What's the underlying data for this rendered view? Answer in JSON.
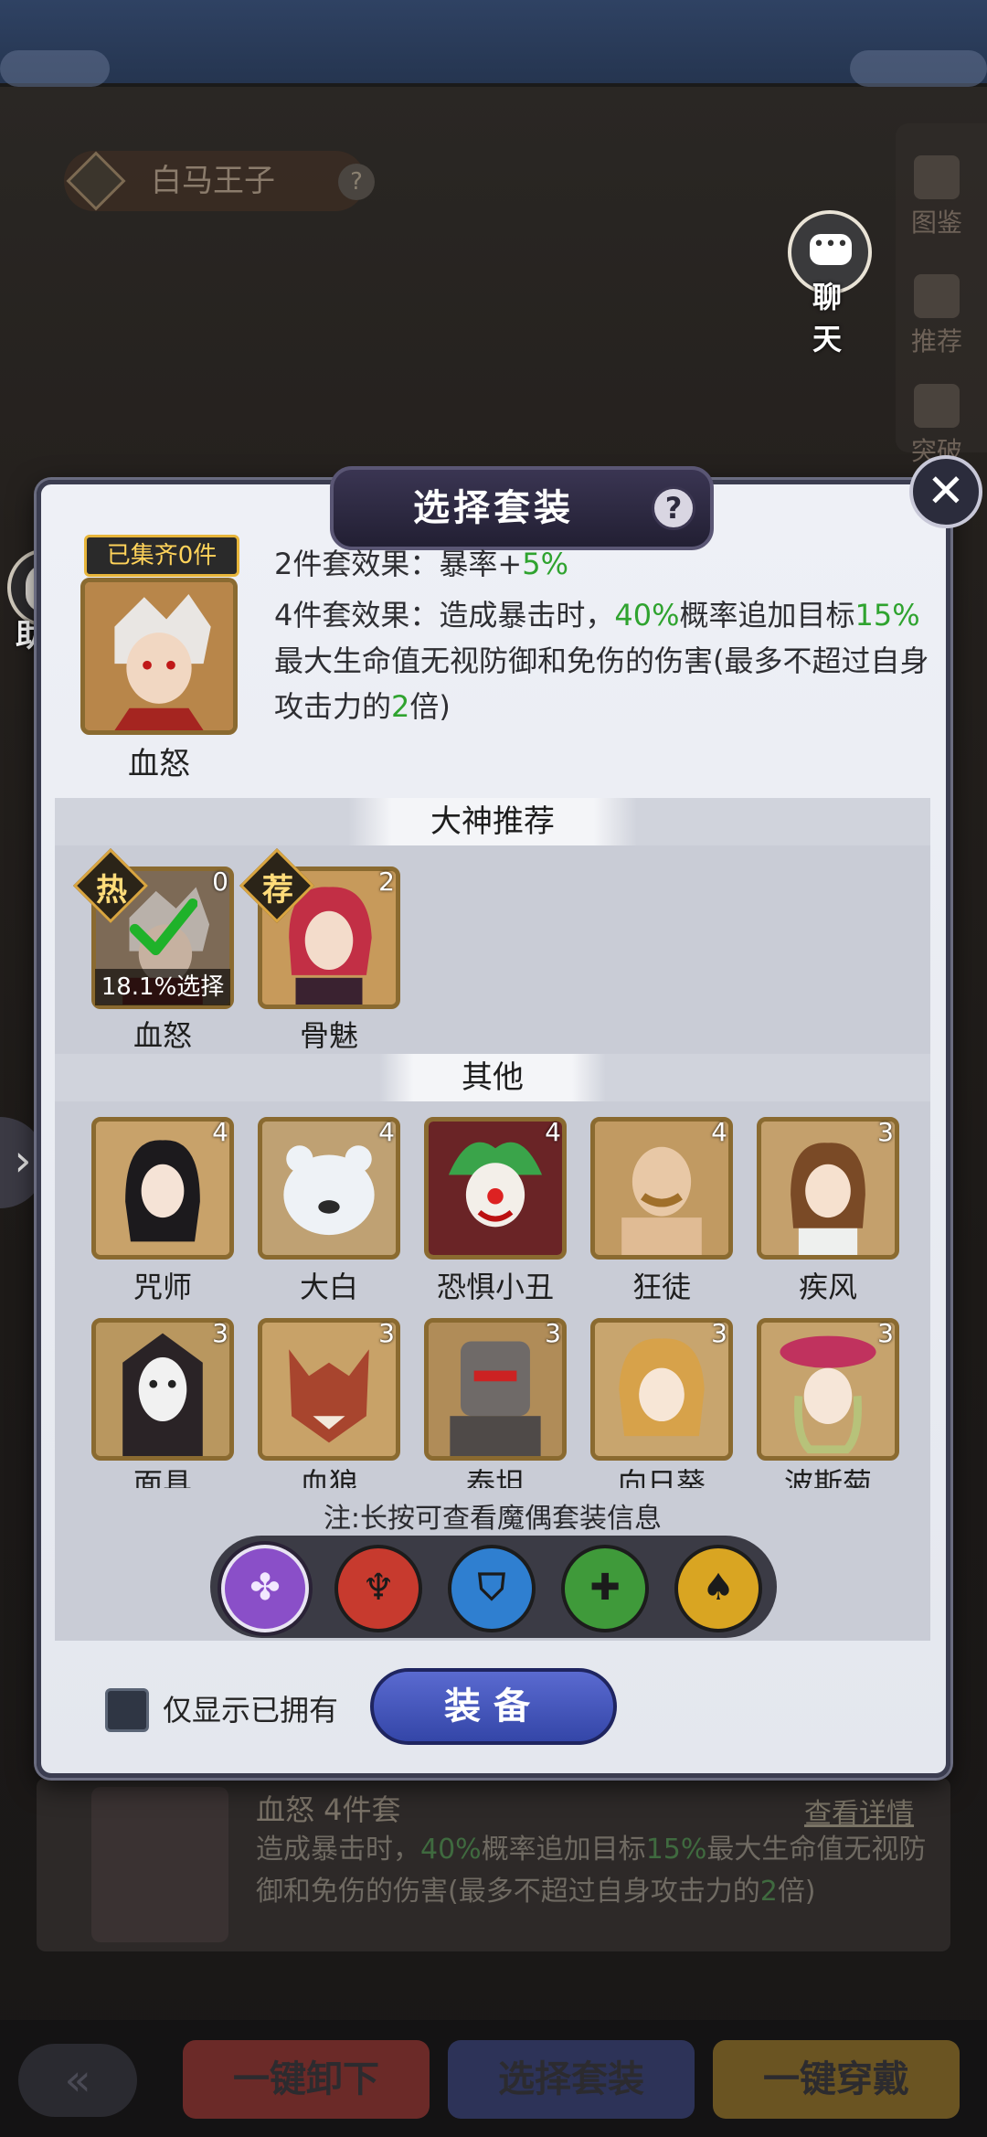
{
  "background": {
    "hero_title": "白马王子",
    "help_glyph": "?",
    "side_buttons": [
      "图鉴",
      "推荐",
      "突破"
    ],
    "chat_label": "聊 天",
    "helper_label": "助手",
    "left_arrow": "›"
  },
  "modal": {
    "title": "选择套装",
    "help_glyph": "?",
    "close_glyph": "✕",
    "collected_badge": "已集齐0件",
    "current_set": "血怒",
    "effect2": {
      "label": "2件套效果：",
      "text": "暴率+",
      "value": "5%"
    },
    "effect4": {
      "label": "4件套效果：",
      "part1": "造成暴击时，",
      "v1": "40%",
      "part2": "概率追加目标",
      "v2": "15%",
      "part3": "最大生命值无视防御和免伤的伤害(最多不超过自身攻击力的",
      "v3": "2",
      "part4": "倍)"
    },
    "section_recommend": "大神推荐",
    "section_other": "其他",
    "recommended": [
      {
        "name": "血怒",
        "tag": "热",
        "count": "0",
        "pick_rate": "18.1%选择",
        "selected": true
      },
      {
        "name": "骨魅",
        "tag": "荐",
        "count": "2"
      }
    ],
    "others": [
      {
        "name": "咒师",
        "count": "4"
      },
      {
        "name": "大白",
        "count": "4"
      },
      {
        "name": "恐惧小丑",
        "count": "4"
      },
      {
        "name": "狂徒",
        "count": "4"
      },
      {
        "name": "疾风",
        "count": "3"
      },
      {
        "name": "面具",
        "count": "3"
      },
      {
        "name": "血狼",
        "count": "3"
      },
      {
        "name": "泰坦",
        "count": "3"
      },
      {
        "name": "向日葵",
        "count": "3"
      },
      {
        "name": "波斯菊",
        "count": "3"
      }
    ],
    "note": "注:长按可查看魔偶套装信息",
    "filters": [
      {
        "name": "all",
        "color": "#8a4fc8",
        "glyph": "✤",
        "active": true
      },
      {
        "name": "red",
        "color": "#c73a2e",
        "glyph": "♆"
      },
      {
        "name": "blue",
        "color": "#2f7fd0",
        "glyph": "⛉"
      },
      {
        "name": "green",
        "color": "#3f9a3a",
        "glyph": "✚"
      },
      {
        "name": "yellow",
        "color": "#d9a522",
        "glyph": "♠"
      }
    ],
    "owned_only_label": "仅显示已拥有",
    "equip_label": "装备"
  },
  "underlay": {
    "title": "血怒 4件套",
    "detail_link": "查看详情",
    "desc1": "造成暴击时，",
    "v1": "40%",
    "desc2": "概率追加目标",
    "v2": "15%",
    "desc3": "最大生命值无视防御和免伤的伤害(最多不超过自身攻击力的",
    "v3": "2",
    "desc4": "倍)"
  },
  "bottom_bar": {
    "back_glyph": "«",
    "unequip_all": "一键卸下",
    "select_set": "选择套装",
    "equip_all": "一键穿戴"
  }
}
